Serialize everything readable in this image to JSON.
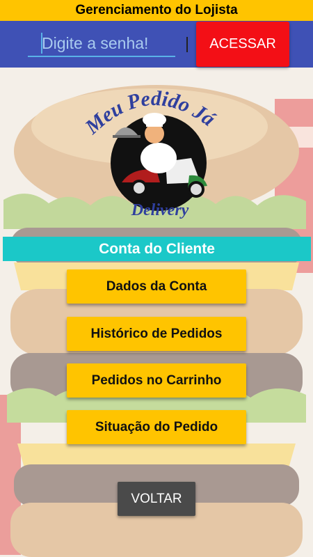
{
  "header": {
    "title": "Gerenciamento do Lojista"
  },
  "login": {
    "password_placeholder": "Digite a senha!",
    "access_label": "ACESSAR"
  },
  "logo": {
    "brand_text": "Meu Pedido Já",
    "sub_text": "Delivery"
  },
  "section": {
    "title": "Conta do Cliente"
  },
  "menu": {
    "items": [
      {
        "label": "Dados da Conta"
      },
      {
        "label": "Histórico de Pedidos"
      },
      {
        "label": "Pedidos no Carrinho"
      },
      {
        "label": "Situação do Pedido"
      }
    ]
  },
  "back_label": "VOLTAR",
  "colors": {
    "header_yellow": "#ffc400",
    "login_bar_blue": "#3f51b5",
    "access_red": "#f30f16",
    "section_teal": "#1bc8c8",
    "menu_yellow": "#ffc400",
    "back_gray": "#4a4a4a"
  }
}
